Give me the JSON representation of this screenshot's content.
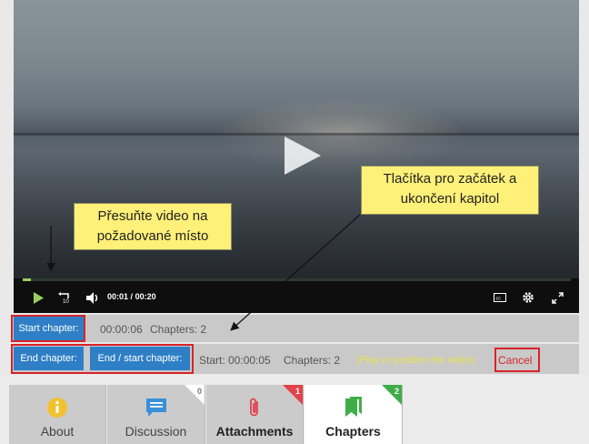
{
  "player": {
    "time_current": "00:01",
    "time_separator": "/",
    "time_total": "00:20",
    "progress_fraction": 0.015,
    "accent_color": "#9bcf5c",
    "icons": [
      "play-icon",
      "replay-10-icon",
      "volume-icon",
      "cc-icon",
      "settings-icon",
      "fullscreen-icon"
    ]
  },
  "chapters_bar": {
    "start_chapter_label": "Start chapter:",
    "start_time": "00:00:06",
    "chapters_count_label": "Chapters: 2",
    "end_chapter_label": "End chapter:",
    "end_start_chapter_label": "End / start chapter:",
    "start_info": "Start: 00:00:05",
    "chapters_info": "Chapters: 2",
    "hint": "(Play or position the video)",
    "cancel_label": "Cancel"
  },
  "callouts": {
    "buttons_note": "Tlačítka pro začátek a ukončení kapitol",
    "seek_note": "Přesuňte video na požadované místo"
  },
  "tabs": [
    {
      "label": "About",
      "icon": "info-icon",
      "badge": ""
    },
    {
      "label": "Discussion",
      "icon": "chat-icon",
      "badge": "0"
    },
    {
      "label": "Attachments",
      "icon": "paperclip-icon",
      "badge": "1"
    },
    {
      "label": "Chapters",
      "icon": "bookmark-icon",
      "badge": "2"
    }
  ],
  "colors": {
    "button_blue": "#2f7fc6",
    "highlight_red": "#d8232a",
    "callout_yellow": "#fef079",
    "hint_yellow": "#e8e34d",
    "tab_green": "#3fae49"
  }
}
